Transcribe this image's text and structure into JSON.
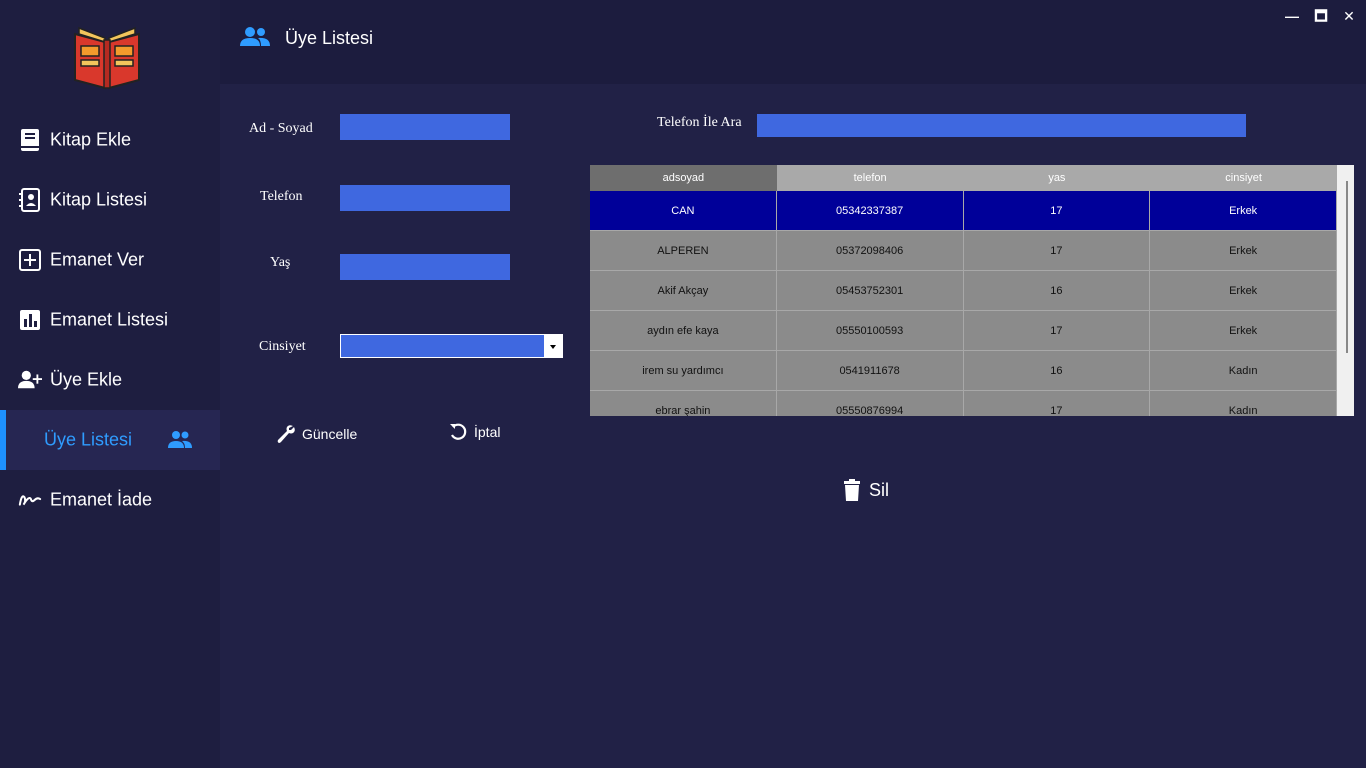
{
  "sidebar": {
    "items": [
      {
        "label": "Kitap Ekle",
        "icon": "book-icon"
      },
      {
        "label": "Kitap Listesi",
        "icon": "contact-book-icon"
      },
      {
        "label": "Emanet Ver",
        "icon": "plus-box-icon"
      },
      {
        "label": "Emanet Listesi",
        "icon": "bar-chart-icon"
      },
      {
        "label": "Üye Ekle",
        "icon": "user-plus-icon"
      },
      {
        "label": "Üye Listesi",
        "icon": "users-icon",
        "active": true
      },
      {
        "label": "Emanet İade",
        "icon": "signature-icon"
      }
    ]
  },
  "header": {
    "title": "Üye Listesi",
    "window_controls": {
      "minimize": "—",
      "maximize": "🗖",
      "close": "✕"
    }
  },
  "form": {
    "name_label": "Ad - Soyad",
    "name_value": "",
    "phone_label": "Telefon",
    "phone_value": "",
    "age_label": "Yaş",
    "age_value": "",
    "gender_label": "Cinsiyet",
    "gender_value": "",
    "update_button": "Güncelle",
    "cancel_button": "İptal"
  },
  "search": {
    "label": "Telefon İle Ara",
    "value": ""
  },
  "table": {
    "columns": [
      "adsoyad",
      "telefon",
      "yas",
      "cinsiyet"
    ],
    "rows": [
      [
        "CAN",
        "05342337387",
        "17",
        "Erkek"
      ],
      [
        "ALPEREN",
        "05372098406",
        "17",
        "Erkek"
      ],
      [
        "Akif Akçay",
        "05453752301",
        "16",
        "Erkek"
      ],
      [
        "aydın efe kaya",
        "05550100593",
        "17",
        "Erkek"
      ],
      [
        "irem su yardımcı",
        "0541911678",
        "16",
        "Kadın"
      ],
      [
        "ebrar şahin",
        "05550876994",
        "17",
        "Kadın"
      ]
    ],
    "selected_row": 0
  },
  "delete_button": "Sil",
  "colors": {
    "background": "#212146",
    "sidebar": "#1e1e40",
    "accent": "#1e90ff",
    "input": "#3f68e0",
    "selected_row": "#000099"
  }
}
